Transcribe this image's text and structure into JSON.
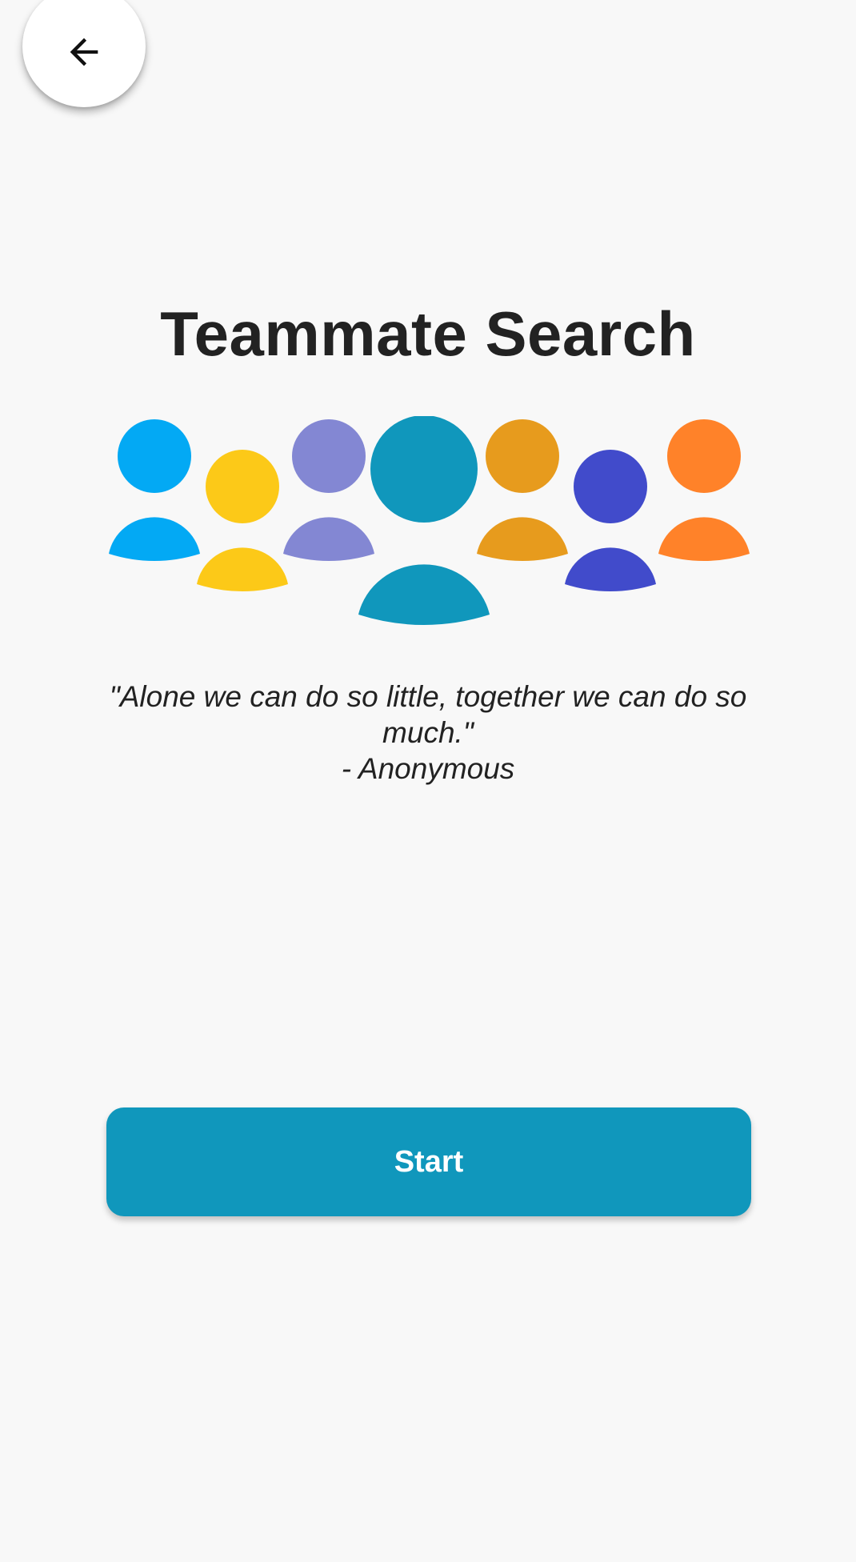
{
  "header": {
    "back_icon": "arrow-back-icon"
  },
  "main": {
    "title": "Teammate Search",
    "illustration": {
      "icon": "group-people-icon",
      "colors": [
        "#03a9f4",
        "#fcc918",
        "#8387d3",
        "#1097bc",
        "#e79b1d",
        "#414bcb",
        "#ff8229"
      ]
    },
    "quote": {
      "line1": "\"Alone we can do so little, together we can do so much.\"",
      "author": "- Anonymous"
    },
    "start_label": "Start",
    "accent_color": "#1097bc"
  }
}
